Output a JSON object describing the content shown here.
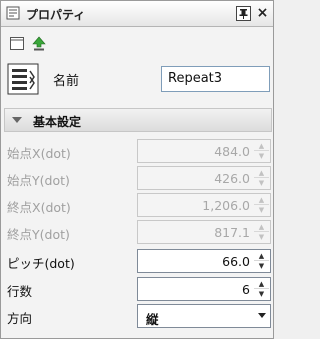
{
  "window": {
    "title": "プロパティ",
    "title_icon": "properties-icon",
    "pin_icon": "pin-icon",
    "close_label": "×"
  },
  "toolbar": {
    "items": [
      {
        "icon": "window-frame-icon"
      },
      {
        "icon": "green-up-arrow-icon"
      }
    ]
  },
  "object": {
    "icon": "repeat-object-icon",
    "name_label": "名前",
    "name_value": "Repeat3"
  },
  "section": {
    "label": "基本設定",
    "expanded": true
  },
  "properties": [
    {
      "label": "始点X(dot)",
      "value": "484.0",
      "enabled": false
    },
    {
      "label": "始点Y(dot)",
      "value": "426.0",
      "enabled": false
    },
    {
      "label": "終点X(dot)",
      "value": "1,206.0",
      "enabled": false
    },
    {
      "label": "終点Y(dot)",
      "value": "817.1",
      "enabled": false
    },
    {
      "label": "ピッチ(dot)",
      "value": "66.0",
      "enabled": true
    },
    {
      "label": "行数",
      "value": "6",
      "enabled": true
    }
  ],
  "direction": {
    "label": "方向",
    "value": "縦"
  },
  "colors": {
    "disabled_text": "#a0a0a0",
    "accent_green": "#3aa63a"
  }
}
